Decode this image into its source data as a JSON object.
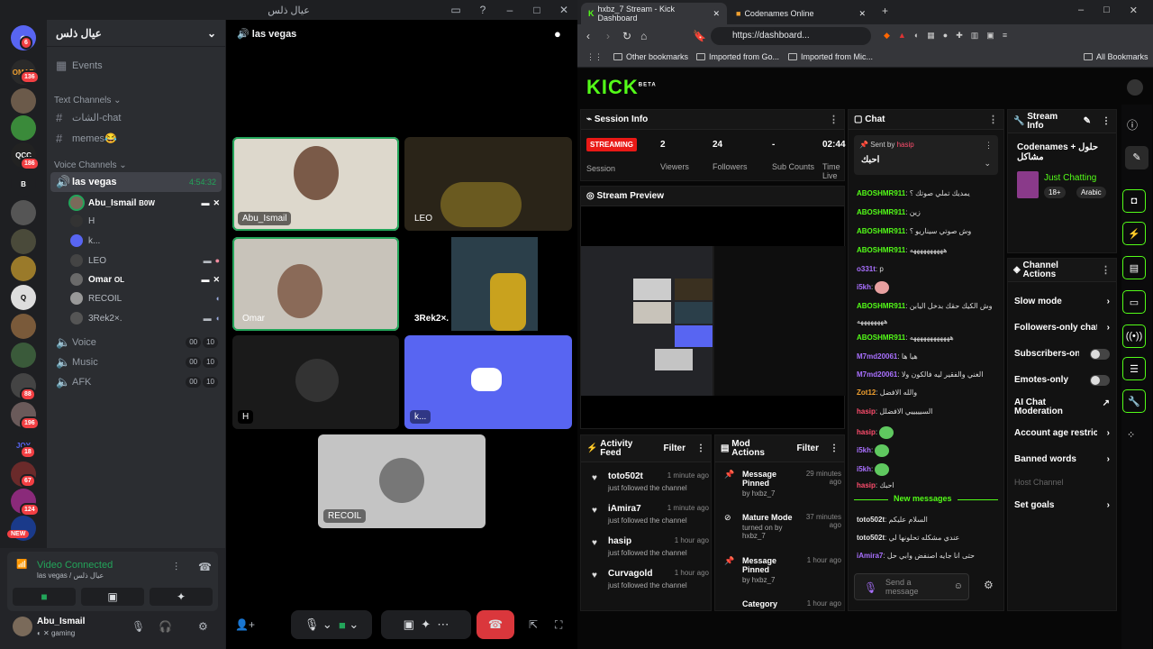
{
  "discord": {
    "window_title": "عيال ذلس",
    "server_name": "عيال ذلس",
    "events": "Events",
    "text_channels_label": "Text Channels",
    "text_channels": [
      "الشات-chat",
      "memes😂"
    ],
    "voice_channels_label": "Voice Channels",
    "active_channel": {
      "name": "las vegas",
      "timer": "4:54:32"
    },
    "voice_users": [
      {
        "name": "Abu_Ismail",
        "tag": "B0W"
      },
      {
        "name": "H",
        "tag": ""
      },
      {
        "name": "k...",
        "tag": ""
      },
      {
        "name": "LEO",
        "tag": ""
      },
      {
        "name": "Omar",
        "tag": "OL"
      },
      {
        "name": "RECOIL",
        "tag": ""
      },
      {
        "name": "3Rek2×.",
        "tag": ""
      }
    ],
    "other_voice": [
      {
        "name": "Voice",
        "a": "00",
        "b": "10"
      },
      {
        "name": "Music",
        "a": "00",
        "b": "10"
      },
      {
        "name": "AFK",
        "a": "00",
        "b": "10"
      }
    ],
    "server_badges": [
      "6",
      "136",
      "186",
      "",
      "88",
      "196",
      "18",
      "67",
      "124",
      "NEW"
    ],
    "server_labels": [
      "OMAR",
      "QCC",
      "B",
      "JOY"
    ],
    "connection_status": "Video Connected",
    "connection_sub": "las vegas / عيال ذلس",
    "user": {
      "name": "Abu_Ismail",
      "status": "gaming"
    },
    "stage_title": "las vegas",
    "tiles": [
      "Abu_Ismail",
      "LEO",
      "Omar",
      "3Rek2×.",
      "H",
      "k...",
      "RECOIL"
    ]
  },
  "browser": {
    "tabs": [
      {
        "title": "hxbz_7 Stream - Kick Dashboard"
      },
      {
        "title": "Codenames Online"
      }
    ],
    "url": "https://dashboard...",
    "bookmarks": [
      "Other bookmarks",
      "Imported from Go...",
      "Imported from Mic...",
      "All Bookmarks"
    ]
  },
  "kick": {
    "logo": "KICK",
    "beta": "BETA",
    "session_info": {
      "title": "Session Info",
      "badge": "STREAMING",
      "session_label": "Session",
      "viewers": "2",
      "viewers_label": "Viewers",
      "followers": "24",
      "followers_label": "Followers",
      "subs": "-",
      "subs_label": "Sub Counts",
      "time": "02:44",
      "time_label": "Time Live"
    },
    "stream_preview": "Stream Preview",
    "activity": {
      "title": "Activity Feed",
      "filter": "Filter",
      "items": [
        {
          "name": "toto502t",
          "time": "1 minute ago",
          "text": "just followed the channel"
        },
        {
          "name": "iAmira7",
          "time": "1 minute ago",
          "text": "just followed the channel"
        },
        {
          "name": "hasip",
          "time": "1 hour ago",
          "text": "just followed the channel"
        },
        {
          "name": "Curvagold",
          "time": "1 hour ago",
          "text": "just followed the channel"
        }
      ]
    },
    "mod_actions": {
      "title": "Mod Actions",
      "filter": "Filter",
      "items": [
        {
          "title": "Message Pinned",
          "by": "by hxbz_7",
          "time": "29 minutes ago"
        },
        {
          "title": "Mature Mode",
          "by": "turned on by hxbz_7",
          "time": "37 minutes ago"
        },
        {
          "title": "Message Pinned",
          "by": "by hxbz_7",
          "time": "1 hour ago"
        },
        {
          "title": "Category",
          "by": "",
          "time": "1 hour ago"
        }
      ]
    },
    "chat": {
      "title": "Chat",
      "pinned_by": "Sent by",
      "pinned_user": "hasip",
      "pinned_text": "احبك",
      "messages": [
        {
          "user": "ABOSHMR911",
          "color": "#53fc18",
          "text": "يمديك تملي صوتك ؟"
        },
        {
          "user": "ABOSHMR911",
          "color": "#53fc18",
          "text": "زين"
        },
        {
          "user": "ABOSHMR911",
          "color": "#53fc18",
          "text": "وش صوتي سيناريو ؟"
        },
        {
          "user": "ABOSHMR911",
          "color": "#53fc18",
          "text": "ههههههههههه"
        },
        {
          "user": "o331t",
          "color": "#a970ff",
          "text": "p"
        },
        {
          "user": "i5kh",
          "color": "#a970ff",
          "text": ""
        },
        {
          "user": "ABOSHMR911",
          "color": "#53fc18",
          "text": "وش الكيك حقك بدخل اليابن"
        },
        {
          "user": "",
          "color": "#53fc18",
          "text": "ههههههههه"
        },
        {
          "user": "ABOSHMR911",
          "color": "#53fc18",
          "text": "ههههههههههههه"
        },
        {
          "user": "M7md20061",
          "color": "#a970ff",
          "text": "هيا ها"
        },
        {
          "user": "M7md20061",
          "color": "#a970ff",
          "text": "الغني والفقير ليه فالكون ولا"
        },
        {
          "user": "Zot12",
          "color": "#f0a030",
          "text": "والله الافضل"
        },
        {
          "user": "hasip",
          "color": "#ff4d6d",
          "text": "السيييييي الافضلل"
        },
        {
          "user": "hasip",
          "color": "#ff4d6d",
          "text": ""
        },
        {
          "user": "i5kh",
          "color": "#a970ff",
          "text": ""
        },
        {
          "user": "i5kh",
          "color": "#a970ff",
          "text": ""
        },
        {
          "user": "hasip",
          "color": "#ff4d6d",
          "text": "احبك"
        }
      ],
      "new_messages": "New messages",
      "new": [
        {
          "user": "toto502t",
          "color": "#e8e8e8",
          "text": "السلام عليكم"
        },
        {
          "user": "toto502t",
          "color": "#e8e8e8",
          "text": "عندي مشكله تحلونها لي"
        },
        {
          "user": "iAmira7",
          "color": "#a970ff",
          "text": "حتى انا جايه اصنفض وابي حل"
        }
      ],
      "input_placeholder": "Send a message"
    },
    "stream_info": {
      "title": "Stream Info",
      "name": "Codenames + حلول مشاكل",
      "category": "Just Chatting",
      "tags": [
        "18+",
        "Arabic"
      ]
    },
    "channel_actions": {
      "title": "Channel Actions",
      "items": [
        "Slow mode",
        "Followers-only chat",
        "Subscribers-only",
        "Emotes-only",
        "AI Chat Moderation",
        "Account age restriction",
        "Banned words",
        "Host Channel",
        "Set goals"
      ]
    }
  },
  "colors": {
    "kick_green": "#53fc18",
    "discord_blurple": "#5865f2",
    "streaming_red": "#e91916"
  }
}
